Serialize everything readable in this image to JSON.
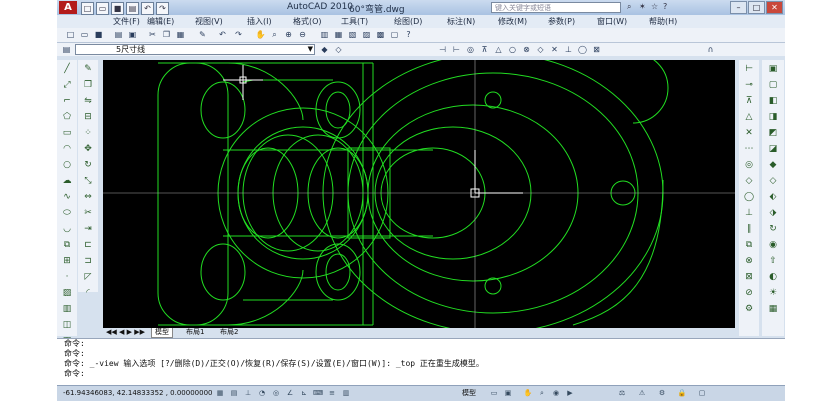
{
  "window": {
    "app_title": "AutoCAD 2010",
    "file_name": "60°弯管.dwg",
    "search_placeholder": "键入关键字或短语"
  },
  "menu": {
    "items": [
      "文件(F)",
      "编辑(E)",
      "视图(V)",
      "插入(I)",
      "格式(O)",
      "工具(T)",
      "绘图(D)",
      "标注(N)",
      "修改(M)",
      "参数(P)",
      "窗口(W)",
      "帮助(H)"
    ]
  },
  "layer": {
    "current": "5尺寸线"
  },
  "tabs": {
    "model": "模型",
    "layout1": "布局1",
    "layout2": "布局2"
  },
  "command": {
    "line1": "命令:",
    "line2": "命令:",
    "line3": "命令: _-view 输入选项 [?/删除(D)/正交(O)/恢复(R)/保存(S)/设置(E)/窗口(W)]: _top 正在重生成模型。",
    "line4": "命令:"
  },
  "status": {
    "coordinates": "-61.94346083, 42.14833352 , 0.00000000",
    "model_button": "模型"
  },
  "colors": {
    "drawing": "#22dd22",
    "canvas": "#000000"
  },
  "icons": [
    "app-logo-icon",
    "new-icon",
    "open-icon",
    "save-icon",
    "undo-icon",
    "redo-icon",
    "zoom-icon",
    "pan-icon",
    "line-icon",
    "circle-icon",
    "arc-icon",
    "text-icon",
    "ucs-icon"
  ]
}
